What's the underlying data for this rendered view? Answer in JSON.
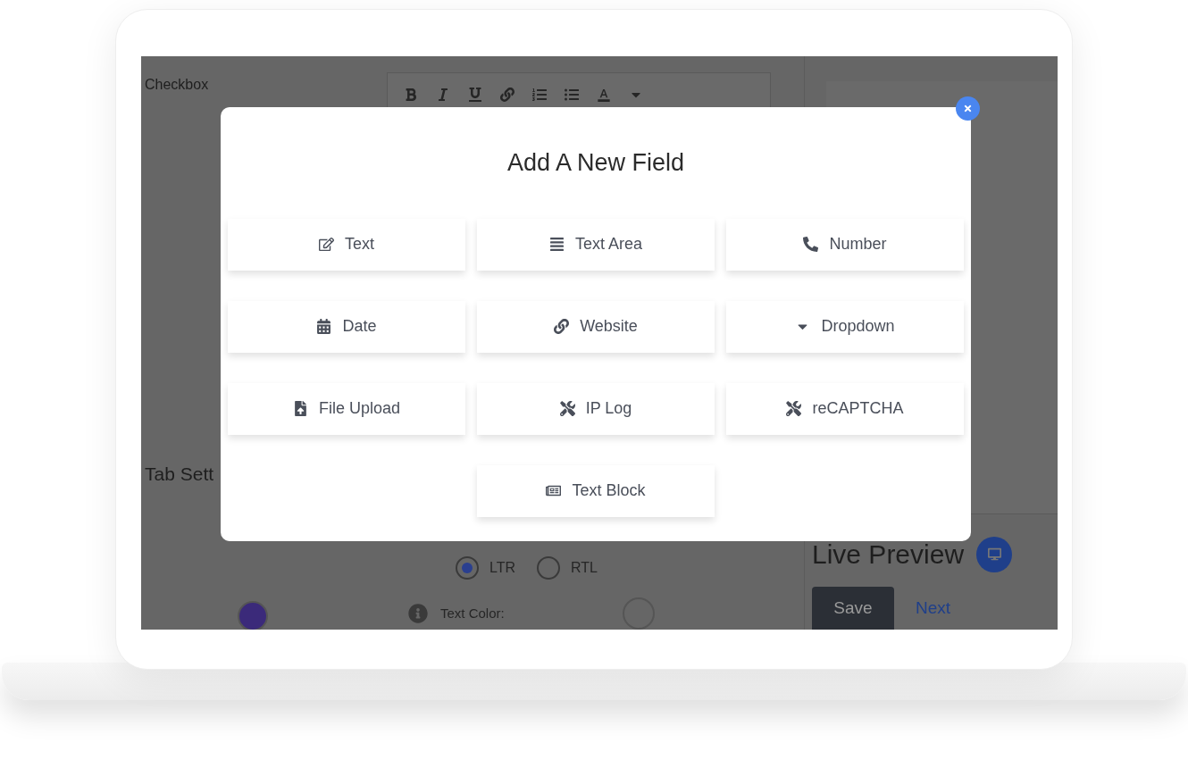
{
  "background": {
    "left_label": "Checkbox",
    "section_heading": "Tab Sett",
    "direction_options": [
      {
        "label": "LTR",
        "selected": true
      },
      {
        "label": "RTL",
        "selected": false
      }
    ],
    "text_color_label": "Text Color:",
    "live_preview_title": "Live Preview",
    "buttons": [
      {
        "label": "Save",
        "kind": "primary"
      },
      {
        "label": "Next",
        "kind": "link"
      }
    ]
  },
  "modal": {
    "title": "Add A New Field",
    "fields": [
      {
        "label": "Text",
        "kind": "text"
      },
      {
        "label": "Text Area",
        "kind": "textarea"
      },
      {
        "label": "Number",
        "kind": "number"
      },
      {
        "label": "Date",
        "kind": "date"
      },
      {
        "label": "Website",
        "kind": "website"
      },
      {
        "label": "Dropdown",
        "kind": "dropdown"
      },
      {
        "label": "File Upload",
        "kind": "file"
      },
      {
        "label": "IP Log",
        "kind": "iplog"
      },
      {
        "label": "reCAPTCHA",
        "kind": "recaptcha"
      },
      {
        "label": "Text Block",
        "kind": "textblock"
      }
    ]
  }
}
